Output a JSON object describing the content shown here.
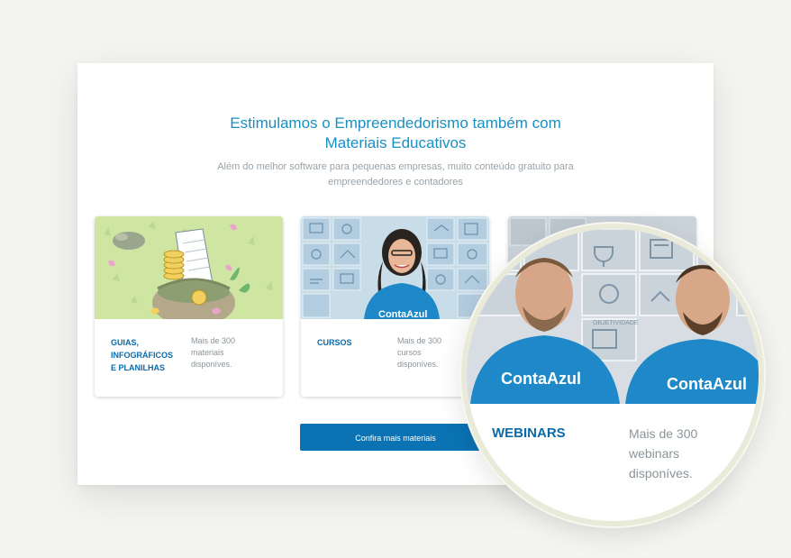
{
  "section": {
    "headline_line1": "Estimulamos o Empreendedorismo também com",
    "headline_line2": "Materiais Educativos",
    "subline_line1": "Além do melhor software para pequenas empresas, muito conteúdo gratuito para",
    "subline_line2": "empreendedores e contadores"
  },
  "cards": [
    {
      "title_lines": [
        "GUIAS,",
        "INFOGRÁFICOS",
        "E PLANILHAS"
      ],
      "desc_lines": [
        "Mais de 300",
        "materiais",
        "disponíves."
      ]
    },
    {
      "title_lines": [
        "CURSOS"
      ],
      "desc_lines": [
        "Mais de 300",
        "cursos",
        "disponíves."
      ],
      "shirt_logo": "ContaAzul"
    }
  ],
  "cta": {
    "label": "Confira mais materiais"
  },
  "magnifier": {
    "title": "WEBINARS",
    "desc_lines": [
      "Mais de 300",
      "webinars",
      "disponíves."
    ],
    "shirt_logo": "ContaAzul"
  },
  "colors": {
    "accent_blue": "#0b73b4",
    "title_blue": "#0b6aa8",
    "headline_blue": "#1a8fc2",
    "muted_gray": "#8b949a"
  }
}
